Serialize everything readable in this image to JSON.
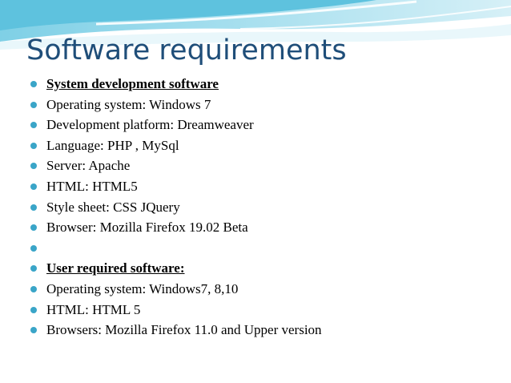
{
  "slide": {
    "title": "Software requirements",
    "accent_color": "#3aa5c8",
    "title_color": "#1f4e79",
    "bullets": [
      {
        "text": "System development software",
        "emphasis": true
      },
      {
        "text": "Operating system: Windows 7",
        "emphasis": false
      },
      {
        "text": "Development platform: Dreamweaver",
        "emphasis": false
      },
      {
        "text": "Language: PHP , MySql",
        "emphasis": false
      },
      {
        "text": "Server: Apache",
        "emphasis": false
      },
      {
        "text": "HTML: HTML5",
        "emphasis": false
      },
      {
        "text": "Style sheet: CSS JQuery",
        "emphasis": false
      },
      {
        "text": "Browser: Mozilla Firefox 19.02 Beta",
        "emphasis": false
      },
      {
        "text": "",
        "emphasis": false
      },
      {
        "text": "User required software:",
        "emphasis": true
      },
      {
        "text": "Operating system: Windows7, 8,10",
        "emphasis": false
      },
      {
        "text": "HTML: HTML 5",
        "emphasis": false
      },
      {
        "text": "Browsers: Mozilla Firefox 11.0 and Upper version",
        "emphasis": false
      }
    ]
  }
}
